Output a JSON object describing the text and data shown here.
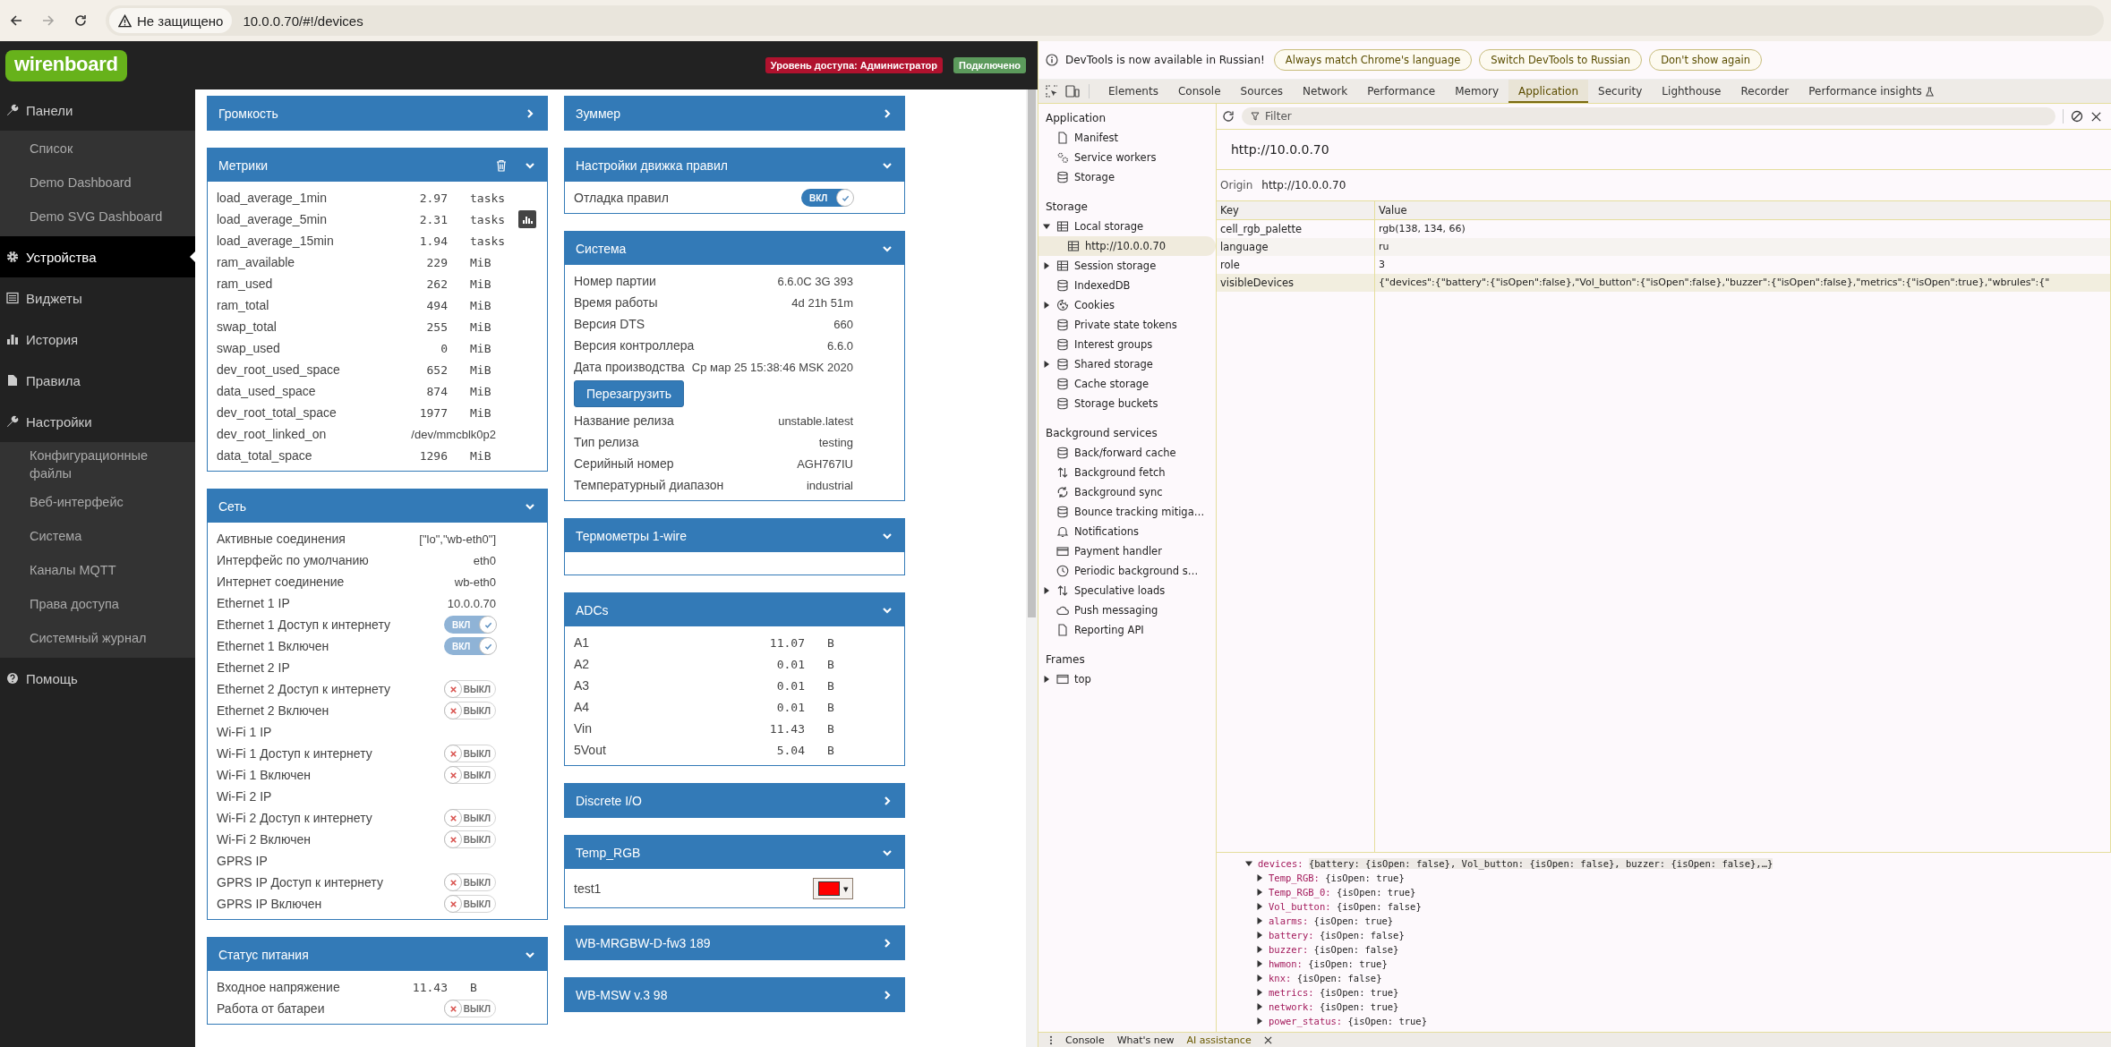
{
  "browser": {
    "forward_disabled": true,
    "security_label": "Не защищено",
    "url": "10.0.0.70/#!/devices"
  },
  "header": {
    "logo": "wirenboard",
    "access_badge": "Уровень доступа: Администратор",
    "connection_badge": "Подключено"
  },
  "sidebar": [
    {
      "kind": "wrench",
      "label": "Панели",
      "selected": false,
      "children": [
        {
          "label": "Список",
          "selected": false
        },
        {
          "label": "Demo Dashboard",
          "selected": false
        },
        {
          "label": "Demo SVG Dashboard",
          "selected": false
        }
      ]
    },
    {
      "kind": "gear",
      "label": "Устройства",
      "selected": true
    },
    {
      "kind": "list",
      "label": "Виджеты",
      "selected": false
    },
    {
      "kind": "bars",
      "label": "История",
      "selected": false
    },
    {
      "kind": "file",
      "label": "Правила",
      "selected": false
    },
    {
      "kind": "wrench",
      "label": "Настройки",
      "selected": false,
      "children": [
        {
          "label": "Конфигурационные файлы",
          "selected": false
        },
        {
          "label": "Веб-интерфейс",
          "selected": false
        },
        {
          "label": "Система",
          "selected": false
        },
        {
          "label": "Каналы MQTT",
          "selected": false
        },
        {
          "label": "Права доступа",
          "selected": false
        },
        {
          "label": "Системный журнал",
          "selected": false
        }
      ]
    },
    {
      "kind": "help",
      "label": "Помощь",
      "selected": false
    }
  ],
  "columns": [
    [
      {
        "title": "Громкость",
        "expanded": false
      },
      {
        "title": "Метрики",
        "expanded": true,
        "delete_icon": true,
        "rows": [
          {
            "kind": "metric",
            "name": "load_average_1min",
            "value": "2.97",
            "unit": "tasks"
          },
          {
            "kind": "metric",
            "name": "load_average_5min",
            "value": "2.31",
            "unit": "tasks",
            "history_button": true
          },
          {
            "kind": "metric",
            "name": "load_average_15min",
            "value": "1.94",
            "unit": "tasks"
          },
          {
            "kind": "metric",
            "name": "ram_available",
            "value": "229",
            "unit": "MiB"
          },
          {
            "kind": "metric",
            "name": "ram_used",
            "value": "262",
            "unit": "MiB"
          },
          {
            "kind": "metric",
            "name": "ram_total",
            "value": "494",
            "unit": "MiB"
          },
          {
            "kind": "metric",
            "name": "swap_total",
            "value": "255",
            "unit": "MiB"
          },
          {
            "kind": "metric",
            "name": "swap_used",
            "value": "0",
            "unit": "MiB"
          },
          {
            "kind": "metric",
            "name": "dev_root_used_space",
            "value": "652",
            "unit": "MiB"
          },
          {
            "kind": "metric",
            "name": "data_used_space",
            "value": "874",
            "unit": "MiB"
          },
          {
            "kind": "metric",
            "name": "dev_root_total_space",
            "value": "1977",
            "unit": "MiB"
          },
          {
            "kind": "text",
            "name": "dev_root_linked_on",
            "value": "/dev/mmcblk0p2"
          },
          {
            "kind": "metric",
            "name": "data_total_space",
            "value": "1296",
            "unit": "MiB"
          }
        ]
      },
      {
        "title": "Сеть",
        "expanded": true,
        "rows": [
          {
            "kind": "text",
            "name": "Активные соединения",
            "value": "[\"lo\",\"wb-eth0\"]"
          },
          {
            "kind": "text",
            "name": "Интерфейс по умолчанию",
            "value": "eth0"
          },
          {
            "kind": "text",
            "name": "Интернет соединение",
            "value": "wb-eth0"
          },
          {
            "kind": "text",
            "name": "Ethernet 1 IP",
            "value": "10.0.0.70"
          },
          {
            "kind": "switch",
            "name": "Ethernet 1 Доступ к интернету",
            "on": true,
            "disabled": true,
            "state_label": "ВКЛ"
          },
          {
            "kind": "switch",
            "name": "Ethernet 1 Включен",
            "on": true,
            "disabled": true,
            "state_label": "ВКЛ"
          },
          {
            "kind": "text",
            "name": "Ethernet 2 IP"
          },
          {
            "kind": "switch",
            "name": "Ethernet 2 Доступ к интернету",
            "on": false,
            "disabled": true,
            "state_label": "ВЫКЛ"
          },
          {
            "kind": "switch",
            "name": "Ethernet 2 Включен",
            "on": false,
            "disabled": true,
            "state_label": "ВЫКЛ"
          },
          {
            "kind": "text",
            "name": "Wi-Fi 1 IP"
          },
          {
            "kind": "switch",
            "name": "Wi-Fi 1 Доступ к интернету",
            "on": false,
            "disabled": true,
            "state_label": "ВЫКЛ"
          },
          {
            "kind": "switch",
            "name": "Wi-Fi 1 Включен",
            "on": false,
            "disabled": true,
            "state_label": "ВЫКЛ"
          },
          {
            "kind": "text",
            "name": "Wi-Fi 2 IP"
          },
          {
            "kind": "switch",
            "name": "Wi-Fi 2 Доступ к интернету",
            "on": false,
            "disabled": true,
            "state_label": "ВЫКЛ"
          },
          {
            "kind": "switch",
            "name": "Wi-Fi 2 Включен",
            "on": false,
            "disabled": true,
            "state_label": "ВЫКЛ"
          },
          {
            "kind": "text",
            "name": "GPRS IP"
          },
          {
            "kind": "switch",
            "name": "GPRS IP Доступ к интернету",
            "on": false,
            "disabled": true,
            "state_label": "ВЫКЛ"
          },
          {
            "kind": "switch",
            "name": "GPRS IP Включен",
            "on": false,
            "disabled": true,
            "state_label": "ВЫКЛ"
          }
        ]
      },
      {
        "title": "Статус питания",
        "expanded": true,
        "rows": [
          {
            "kind": "metric",
            "name": "Входное напряжение",
            "value": "11.43",
            "unit": "В"
          },
          {
            "kind": "switch",
            "name": "Работа от батареи",
            "on": false,
            "disabled": true,
            "state_label": "ВЫКЛ"
          }
        ]
      }
    ],
    [
      {
        "title": "Зуммер",
        "expanded": false
      },
      {
        "title": "Настройки движка правил",
        "expanded": true,
        "rows": [
          {
            "kind": "switch",
            "name": "Отладка правил",
            "on": true,
            "disabled": false,
            "state_label": "ВКЛ"
          }
        ]
      },
      {
        "title": "Система",
        "expanded": true,
        "rows": [
          {
            "kind": "text",
            "name": "Номер партии",
            "value": "6.6.0C 3G 393"
          },
          {
            "kind": "text",
            "name": "Время работы",
            "value": "4d 21h 51m"
          },
          {
            "kind": "text",
            "name": "Версия DTS",
            "value": "660"
          },
          {
            "kind": "text",
            "name": "Версия контроллера",
            "value": "6.6.0"
          },
          {
            "kind": "text",
            "name": "Дата производства",
            "value": "Ср мар 25 15:38:46 MSK 2020"
          },
          {
            "kind": "button",
            "label": "Перезагрузить"
          },
          {
            "kind": "text",
            "name": "Название релиза",
            "value": "unstable.latest"
          },
          {
            "kind": "text",
            "name": "Тип релиза",
            "value": "testing"
          },
          {
            "kind": "text",
            "name": "Серийный номер",
            "value": "AGH767IU"
          },
          {
            "kind": "text",
            "name": "Температурный диапазон",
            "value": "industrial"
          }
        ]
      },
      {
        "title": "Термометры 1-wire",
        "expanded": true
      },
      {
        "title": "ADCs",
        "expanded": true,
        "rows": [
          {
            "kind": "metric",
            "name": "A1",
            "value": "11.07",
            "unit": "В"
          },
          {
            "kind": "metric",
            "name": "A2",
            "value": "0.01",
            "unit": "В"
          },
          {
            "kind": "metric",
            "name": "A3",
            "value": "0.01",
            "unit": "В"
          },
          {
            "kind": "metric",
            "name": "A4",
            "value": "0.01",
            "unit": "В"
          },
          {
            "kind": "metric",
            "name": "Vin",
            "value": "11.43",
            "unit": "В"
          },
          {
            "kind": "metric",
            "name": "5Vout",
            "value": "5.04",
            "unit": "В"
          }
        ]
      },
      {
        "title": "Discrete I/O",
        "expanded": false
      },
      {
        "title": "Temp_RGB",
        "expanded": true,
        "rows": [
          {
            "kind": "color",
            "name": "test1",
            "color": "#ff0000",
            "caret": "▾"
          }
        ]
      },
      {
        "title": "WB-MRGBW-D-fw3 189",
        "expanded": false
      },
      {
        "title": "WB-MSW v.3 98",
        "expanded": false
      }
    ]
  ],
  "devtools": {
    "infobar": {
      "message": "DevTools is now available in Russian!",
      "buttons": [
        "Always match Chrome's language",
        "Switch DevTools to Russian",
        "Don't show again"
      ]
    },
    "tabs": [
      {
        "label": "Elements",
        "selected": false,
        "experimental": false
      },
      {
        "label": "Console",
        "selected": false,
        "experimental": false
      },
      {
        "label": "Sources",
        "selected": false,
        "experimental": false
      },
      {
        "label": "Network",
        "selected": false,
        "experimental": false
      },
      {
        "label": "Performance",
        "selected": false,
        "experimental": false
      },
      {
        "label": "Memory",
        "selected": false,
        "experimental": false
      },
      {
        "label": "Application",
        "selected": true,
        "experimental": false
      },
      {
        "label": "Security",
        "selected": false,
        "experimental": false
      },
      {
        "label": "Lighthouse",
        "selected": false,
        "experimental": false
      },
      {
        "label": "Recorder",
        "selected": false,
        "experimental": false
      },
      {
        "label": "Performance insights",
        "selected": false,
        "experimental": true
      }
    ],
    "sidebar": [
      {
        "title": "Application",
        "items": [
          {
            "label": "Manifest",
            "kind": "file",
            "selected": false
          },
          {
            "label": "Service workers",
            "kind": "gears",
            "selected": false
          },
          {
            "label": "Storage",
            "kind": "db",
            "selected": false
          }
        ]
      },
      {
        "title": "Storage",
        "items": [
          {
            "label": "Local storage",
            "kind": "table",
            "selected": false,
            "expanded": true,
            "children": [
              {
                "label": "http://10.0.0.70",
                "kind": "table",
                "selected": true
              }
            ]
          },
          {
            "label": "Session storage",
            "kind": "table",
            "selected": false,
            "expanded": false
          },
          {
            "label": "IndexedDB",
            "kind": "db",
            "selected": false
          },
          {
            "label": "Cookies",
            "kind": "cookie",
            "selected": false,
            "expanded": false
          },
          {
            "label": "Private state tokens",
            "kind": "db",
            "selected": false
          },
          {
            "label": "Interest groups",
            "kind": "db",
            "selected": false
          },
          {
            "label": "Shared storage",
            "kind": "db",
            "selected": false,
            "expanded": false
          },
          {
            "label": "Cache storage",
            "kind": "db",
            "selected": false
          },
          {
            "label": "Storage buckets",
            "kind": "db",
            "selected": false
          }
        ]
      },
      {
        "title": "Background services",
        "items": [
          {
            "label": "Back/forward cache",
            "kind": "db",
            "selected": false
          },
          {
            "label": "Background fetch",
            "kind": "arrows",
            "selected": false
          },
          {
            "label": "Background sync",
            "kind": "sync",
            "selected": false
          },
          {
            "label": "Bounce tracking mitiga…",
            "kind": "db",
            "selected": false
          },
          {
            "label": "Notifications",
            "kind": "bell",
            "selected": false
          },
          {
            "label": "Payment handler",
            "kind": "card",
            "selected": false
          },
          {
            "label": "Periodic background s…",
            "kind": "clock",
            "selected": false
          },
          {
            "label": "Speculative loads",
            "kind": "arrows",
            "selected": false,
            "expanded": false
          },
          {
            "label": "Push messaging",
            "kind": "cloud",
            "selected": false
          },
          {
            "label": "Reporting API",
            "kind": "file",
            "selected": false
          }
        ]
      },
      {
        "title": "Frames",
        "items": [
          {
            "label": "top",
            "kind": "frame",
            "selected": false,
            "expanded": false
          }
        ]
      }
    ],
    "storage": {
      "filter_placeholder": "Filter",
      "title": "http://10.0.0.70",
      "origin_label": "Origin",
      "origin": "http://10.0.0.70",
      "columns": [
        "Key",
        "Value"
      ],
      "rows": [
        {
          "key": "cell_rgb_palette",
          "value": "rgb(138, 134, 66)",
          "selected": false
        },
        {
          "key": "language",
          "value": "ru",
          "selected": false
        },
        {
          "key": "role",
          "value": "3",
          "selected": false
        },
        {
          "key": "visibleDevices",
          "value": "{\"devices\":{\"battery\":{\"isOpen\":false},\"Vol_button\":{\"isOpen\":false},\"buzzer\":{\"isOpen\":false},\"metrics\":{\"isOpen\":true},\"wbrules\":{\"",
          "selected": true
        }
      ]
    },
    "preview": {
      "key": "devices:",
      "value": "{battery: {isOpen: false}, Vol_button: {isOpen: false}, buzzer: {isOpen: false},…}",
      "expanded": true,
      "children": [
        {
          "key": "Temp_RGB:",
          "value": "{isOpen: true}",
          "expanded": false
        },
        {
          "key": "Temp_RGB_0:",
          "value": "{isOpen: true}",
          "expanded": false
        },
        {
          "key": "Vol_button:",
          "value": "{isOpen: false}",
          "expanded": false
        },
        {
          "key": "alarms:",
          "value": "{isOpen: true}",
          "expanded": false
        },
        {
          "key": "battery:",
          "value": "{isOpen: false}",
          "expanded": false
        },
        {
          "key": "buzzer:",
          "value": "{isOpen: false}",
          "expanded": false
        },
        {
          "key": "hwmon:",
          "value": "{isOpen: true}",
          "expanded": false
        },
        {
          "key": "knx:",
          "value": "{isOpen: false}",
          "expanded": false
        },
        {
          "key": "metrics:",
          "value": "{isOpen: true}",
          "expanded": false
        },
        {
          "key": "network:",
          "value": "{isOpen: true}",
          "expanded": false
        },
        {
          "key": "power_status:",
          "value": "{isOpen: true}",
          "expanded": false
        }
      ]
    },
    "drawer": {
      "tabs": [
        {
          "label": "Console",
          "selected": false
        },
        {
          "label": "What's new",
          "selected": false
        },
        {
          "label": "AI assistance",
          "selected": true
        }
      ]
    }
  }
}
